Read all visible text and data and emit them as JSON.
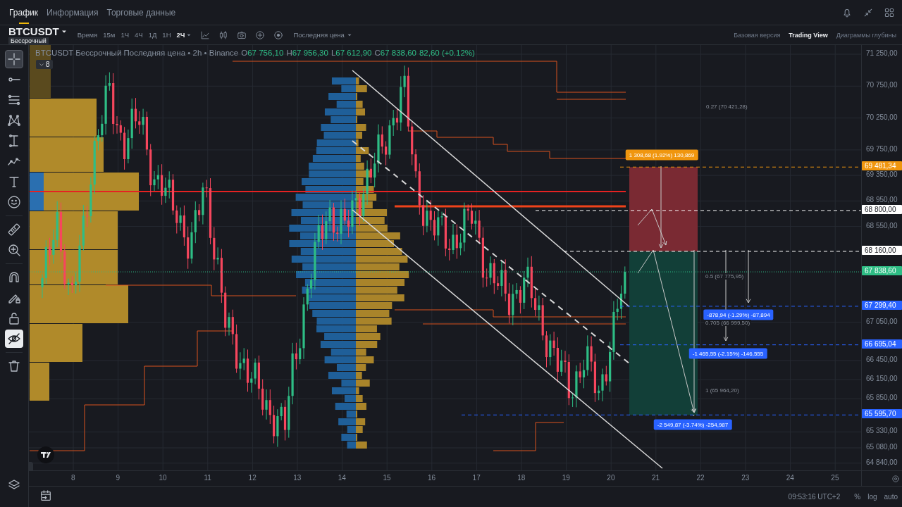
{
  "header": {
    "tabs": [
      {
        "label": "График",
        "selected": true
      },
      {
        "label": "Информация",
        "selected": false
      },
      {
        "label": "Торговые данные",
        "selected": false
      }
    ]
  },
  "toolbar": {
    "symbol": "BTCUSDT",
    "contract": "Бессрочный",
    "time_label": "Время",
    "intervals": [
      {
        "label": "15м",
        "selected": false
      },
      {
        "label": "1Ч",
        "selected": false
      },
      {
        "label": "4Ч",
        "selected": false
      },
      {
        "label": "1Д",
        "selected": false
      },
      {
        "label": "1Н",
        "selected": false
      },
      {
        "label": "2Ч",
        "selected": true
      }
    ],
    "price_source": "Последняя цена",
    "views": [
      {
        "label": "Базовая версия",
        "selected": false
      },
      {
        "label": "Trading View",
        "selected": true
      },
      {
        "label": "Диаграммы глубины",
        "selected": false
      }
    ]
  },
  "tools": [
    {
      "selected": true,
      "on": false
    },
    {
      "selected": false,
      "on": false
    },
    {
      "selected": false,
      "on": false
    },
    {
      "selected": false,
      "on": false
    },
    {
      "selected": false,
      "on": false
    },
    {
      "selected": false,
      "on": false
    },
    {
      "selected": false,
      "on": false
    },
    {
      "selected": false,
      "on": false
    },
    {
      "selected": false,
      "on": false
    },
    {
      "selected": false,
      "on": false
    },
    {
      "selected": false,
      "on": false
    },
    {
      "selected": false,
      "on": false
    },
    {
      "selected": false,
      "on": false
    },
    {
      "selected": false,
      "on": true
    },
    {
      "selected": false,
      "on": false
    }
  ],
  "legend": {
    "title": "BTCUSDT Бессрочный Последняя цена • 2h • Binance",
    "ohlc": [
      {
        "label": "O",
        "value": "67 756,10"
      },
      {
        "label": "H",
        "value": "67 956,30"
      },
      {
        "label": "L",
        "value": "67 612,90"
      },
      {
        "label": "C",
        "value": "67 838,60"
      }
    ],
    "change": "82,60 (+0.12%)",
    "indicator_count": "8"
  },
  "measurements": [
    {
      "text": "1 308,68 (1.92%) 130,869",
      "color": "#f0960e"
    },
    {
      "text": "-878,94 (-1.29%) -87,894",
      "color": "#2962ff"
    },
    {
      "text": "-1 465,55 (-2.15%) -146,555",
      "color": "#2962ff"
    },
    {
      "text": "-2 549,87 (-3.74%) -254,987",
      "color": "#2962ff"
    }
  ],
  "fib_labels": [
    "0.27 (70 421,28)",
    "0.5 (67 775,95)",
    "0.705 (66 999,50)",
    "1 (65 964,20)"
  ],
  "price_axis": {
    "ticks": [
      "71 250,00",
      "70 750,00",
      "70 250,00",
      "69 750,00",
      "69 350,00",
      "68 950,00",
      "68 550,00",
      "67 050,00",
      "66 450,00",
      "66 150,00",
      "65 850,00",
      "65 330,00",
      "65 080,00",
      "64 840,00"
    ],
    "badges": [
      {
        "text": "69 481,34",
        "color": "#f0960e"
      },
      {
        "text": "68 800,00",
        "color": "#ffffff"
      },
      {
        "text": "68 160,00",
        "color": "#ffffff"
      },
      {
        "text": "67 838,60",
        "color": "#2ebd85"
      },
      {
        "text": "67 299,40",
        "color": "#2962ff"
      },
      {
        "text": "66 695,04",
        "color": "#2962ff"
      },
      {
        "text": "65 595,70",
        "color": "#2962ff"
      }
    ]
  },
  "time_axis": {
    "ticks": [
      "8",
      "9",
      "10",
      "11",
      "12",
      "13",
      "14",
      "15",
      "16",
      "17",
      "18",
      "19",
      "20",
      "21",
      "22",
      "23",
      "24",
      "25"
    ]
  },
  "status": {
    "time": "09:53:16 UTC+2",
    "options": [
      "%",
      "log",
      "auto"
    ]
  }
}
